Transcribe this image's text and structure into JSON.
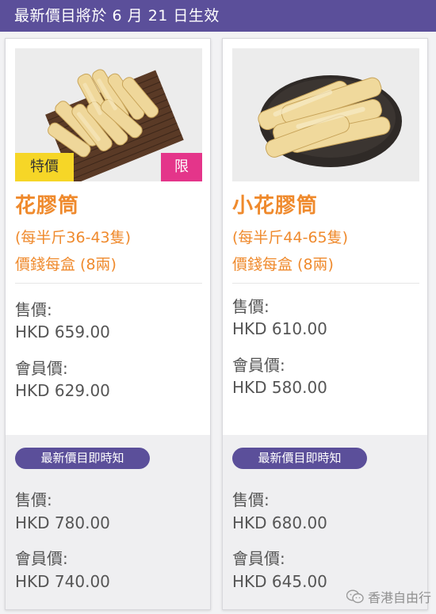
{
  "banner": {
    "text": "最新價目將於 6 月 21 日生效"
  },
  "products": [
    {
      "tags": {
        "special": "特價",
        "limited": "限"
      },
      "name": "花膠筒",
      "spec_count": "(每半斤36-43隻)",
      "spec_price_unit": "價錢每盒 (8兩)",
      "current": {
        "price_label": "售價:",
        "price": "HKD 659.00",
        "member_label": "會員價:",
        "member_price": "HKD 629.00"
      },
      "upcoming": {
        "badge": "最新價目即時知",
        "price_label": "售價:",
        "price": "HKD 780.00",
        "member_label": "會員價:",
        "member_price": "HKD 740.00"
      },
      "image": "dried-fish-maw-on-bamboo-mat"
    },
    {
      "name": "小花膠筒",
      "spec_count": "(每半斤44-65隻)",
      "spec_price_unit": "價錢每盒 (8兩)",
      "current": {
        "price_label": "售價:",
        "price": "HKD 610.00",
        "member_label": "會員價:",
        "member_price": "HKD 580.00"
      },
      "upcoming": {
        "badge": "最新價目即時知",
        "price_label": "售價:",
        "price": "HKD 680.00",
        "member_label": "會員價:",
        "member_price": "HKD 645.00"
      },
      "image": "dried-fish-maw-on-dark-plate"
    }
  ],
  "watermark": {
    "text": "香港自由行",
    "icon": "wechat-icon"
  },
  "colors": {
    "accent_purple": "#5b4f9a",
    "orange_text": "#ef8a2d",
    "tag_yellow": "#f6d627",
    "tag_pink": "#e4358a"
  }
}
